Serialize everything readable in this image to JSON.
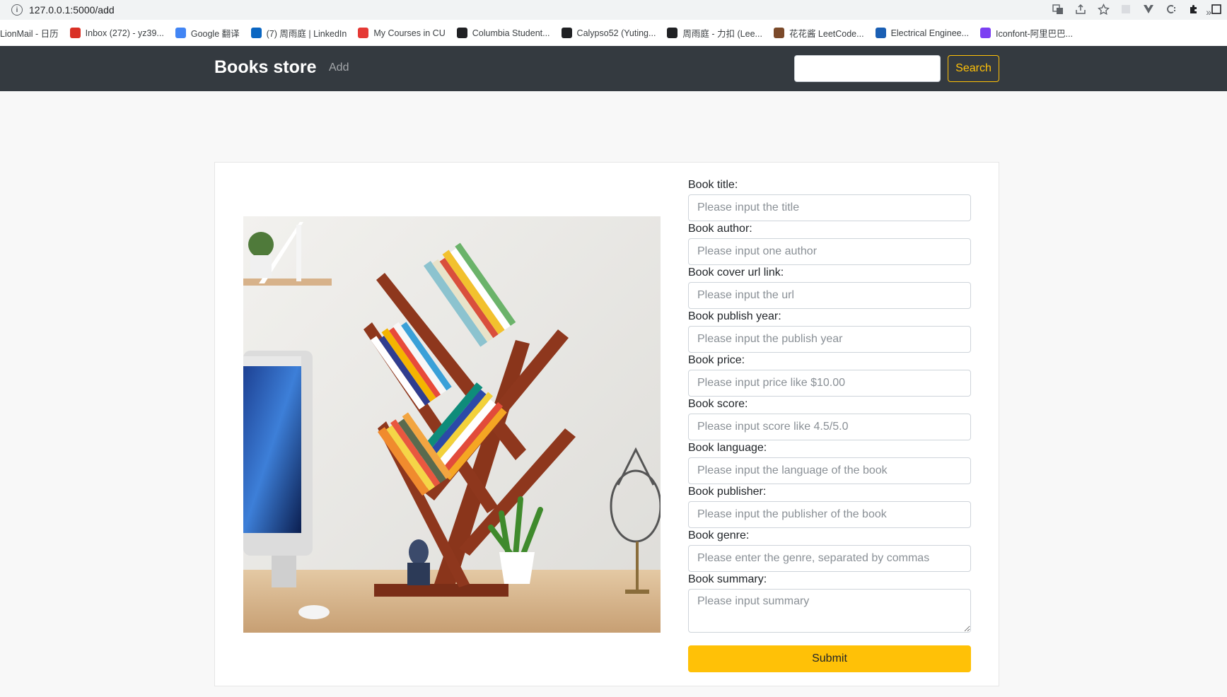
{
  "browser": {
    "url": "127.0.0.1:5000/add",
    "bookmarks": [
      {
        "label": "LionMail - 日历",
        "icon": "lionmail-icon",
        "color": "#ffffff"
      },
      {
        "label": "Inbox (272) - yz39...",
        "icon": "gmail-icon",
        "color": "#d93025"
      },
      {
        "label": "Google 翻译",
        "icon": "google-translate-icon",
        "color": "#4285f4"
      },
      {
        "label": "(7) 周雨庭 | LinkedIn",
        "icon": "linkedin-icon",
        "color": "#0a66c2"
      },
      {
        "label": "My Courses in CU",
        "icon": "courses-icon",
        "color": "#e53935"
      },
      {
        "label": "Columbia Student...",
        "icon": "columbia-icon",
        "color": "#202124"
      },
      {
        "label": "Calypso52 (Yuting...",
        "icon": "github-icon",
        "color": "#202124"
      },
      {
        "label": "周雨庭 - 力扣 (Lee...",
        "icon": "leetcode-cn-icon",
        "color": "#202124"
      },
      {
        "label": "花花酱 LeetCode...",
        "icon": "avatar-icon",
        "color": "#7b4a2a"
      },
      {
        "label": "Electrical Enginee...",
        "icon": "crown-icon",
        "color": "#1a5fb4"
      },
      {
        "label": "Iconfont-阿里巴巴...",
        "icon": "iconfont-icon",
        "color": "#7b3ff2"
      }
    ],
    "more_glyph": "»"
  },
  "navbar": {
    "brand": "Books store",
    "add_link": "Add",
    "search_button": "Search"
  },
  "form": {
    "fields": [
      {
        "label": "Book title:",
        "placeholder": "Please input the title"
      },
      {
        "label": "Book author:",
        "placeholder": "Please input one author"
      },
      {
        "label": "Book cover url link:",
        "placeholder": "Please input the url"
      },
      {
        "label": "Book publish year:",
        "placeholder": "Please input the publish year"
      },
      {
        "label": "Book price:",
        "placeholder": "Please input price like $10.00"
      },
      {
        "label": "Book score:",
        "placeholder": "Please input score like 4.5/5.0"
      },
      {
        "label": "Book language:",
        "placeholder": "Please input the language of the book"
      },
      {
        "label": "Book publisher:",
        "placeholder": "Please input the publisher of the book"
      },
      {
        "label": "Book genre:",
        "placeholder": "Please enter the genre, separated by commas"
      }
    ],
    "summary": {
      "label": "Book summary:",
      "placeholder": "Please input summary"
    },
    "submit": "Submit"
  },
  "colors": {
    "navbar_bg": "#343a40",
    "accent": "#ffc107",
    "page_bg": "#f8f8f8"
  }
}
